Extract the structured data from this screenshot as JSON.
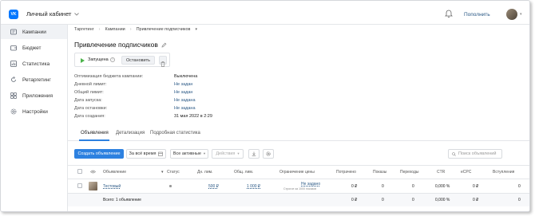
{
  "app": {
    "logo_text": "VK",
    "cabinet_label": "Личный кабинет"
  },
  "header": {
    "topup_label": "Пополнить"
  },
  "sidebar": {
    "items": [
      {
        "label": "Кампании",
        "icon": "campaigns-icon"
      },
      {
        "label": "Бюджет",
        "icon": "wallet-icon"
      },
      {
        "label": "Статистика",
        "icon": "stats-icon"
      },
      {
        "label": "Ретаргетинг",
        "icon": "retarget-icon"
      },
      {
        "label": "Приложения",
        "icon": "apps-icon"
      },
      {
        "label": "Настройки",
        "icon": "gear-icon"
      }
    ]
  },
  "breadcrumb": {
    "items": [
      "Таргетинг",
      "Кампании",
      "Привлечение подписчиков"
    ]
  },
  "campaign": {
    "title": "Привлечение подписчиков",
    "status": "Запущена",
    "stop_label": "Остановить",
    "info": [
      {
        "key": "Оптимизация бюджета кампании:",
        "value": "Выключена",
        "link": false
      },
      {
        "key": "Дневной лимит:",
        "value": "Не задан",
        "link": true
      },
      {
        "key": "Общий лимит:",
        "value": "Не задан",
        "link": true
      },
      {
        "key": "Дата запуска:",
        "value": "Не задана",
        "link": true
      },
      {
        "key": "Дата остановки:",
        "value": "Не задана",
        "link": true
      },
      {
        "key": "Дата создания:",
        "value": "31 мая 2022 в 2:29",
        "link": false
      }
    ]
  },
  "tabs": [
    "Объявления",
    "Детализация",
    "Подробная статистика"
  ],
  "toolbar": {
    "create_label": "Создать объявление",
    "period_label": "За всё время",
    "filter_label": "Все активные",
    "actions_label": "Действия",
    "search_placeholder": "Поиск объявлений"
  },
  "table": {
    "headers": {
      "ad": "Объявление",
      "status": "Статус",
      "day_limit": "Дн. лим.",
      "total_limit": "Общ. лим.",
      "price_limit": "Ограничение цены",
      "spent": "Потрачено",
      "impressions": "Показы",
      "clicks": "Переходы",
      "ctr": "CTR",
      "ecpc": "eCPC",
      "joined": "Вступления"
    },
    "row": {
      "name": "Тестовый",
      "day_limit": "500 ₽",
      "total_limit": "1 000 ₽",
      "price_limit": "Не задано",
      "price_limit_note": "Строгое за 1000 показов",
      "spent": "0 ₽",
      "impressions": "0",
      "clicks": "0",
      "ctr": "0,000 %",
      "ecpc": "0 ₽",
      "joined": "0"
    },
    "total": {
      "label": "Всего: 1 объявление",
      "spent": "0 ₽",
      "impressions": "0",
      "clicks": "0",
      "ctr": "0,000 %",
      "ecpc": "0 ₽",
      "joined": "0"
    }
  },
  "colors": {
    "accent": "#2d81e0",
    "link": "#2a5885",
    "status_running": "#4bb34b"
  }
}
